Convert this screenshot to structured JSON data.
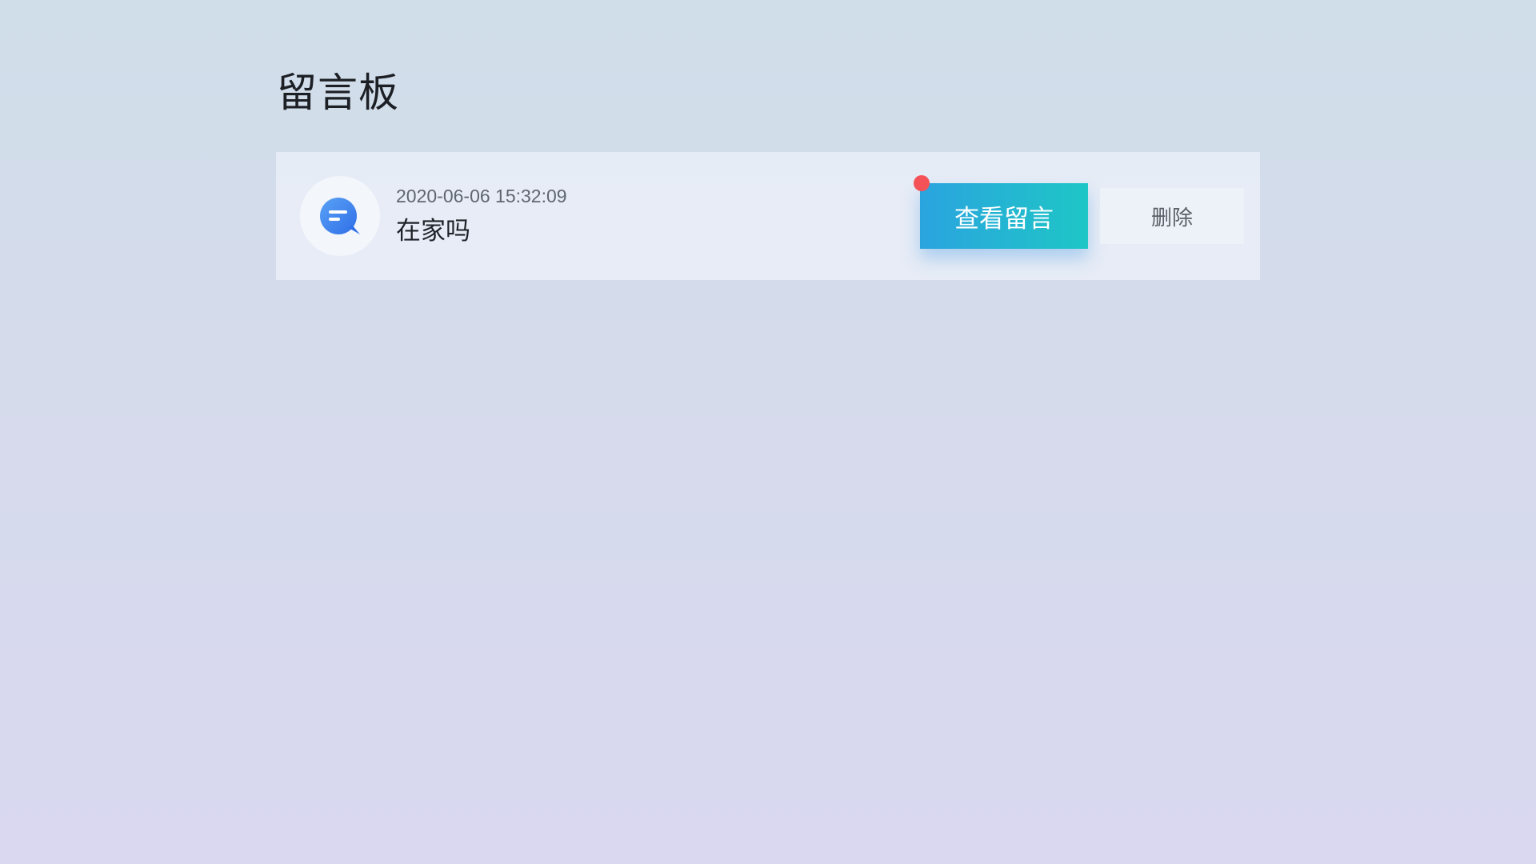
{
  "page": {
    "title": "留言板"
  },
  "messages": [
    {
      "timestamp": "2020-06-06 15:32:09",
      "text": "在家吗",
      "icon": "message-bubble-icon",
      "unread": true,
      "view_label": "查看留言",
      "delete_label": "删除"
    }
  ],
  "colors": {
    "accent_gradient_start": "#2aa4df",
    "accent_gradient_end": "#1ec6c6",
    "unread_dot": "#f45257",
    "icon_blue": "#3c82f0"
  }
}
